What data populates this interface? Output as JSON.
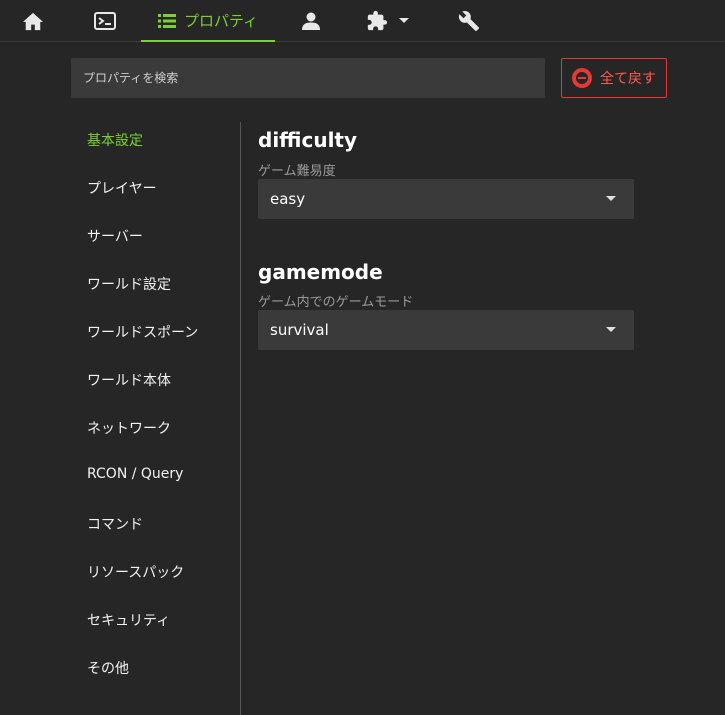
{
  "nav": {
    "home": "home-icon",
    "console": "console-icon",
    "properties_label": "プロパティ",
    "players": "person-icon",
    "plugins": "puzzle-icon",
    "settings": "wrench-icon",
    "accent": "#7cd12e"
  },
  "search": {
    "placeholder": "プロパティを検索"
  },
  "reset": {
    "label": "全て戻す",
    "color": "#e53935"
  },
  "sidebar": {
    "items": [
      {
        "label": "基本設定",
        "active": true
      },
      {
        "label": "プレイヤー"
      },
      {
        "label": "サーバー"
      },
      {
        "label": "ワールド設定"
      },
      {
        "label": "ワールドスポーン"
      },
      {
        "label": "ワールド本体"
      },
      {
        "label": "ネットワーク"
      },
      {
        "label": "RCON / Query"
      },
      {
        "label": "コマンド"
      },
      {
        "label": "リソースパック"
      },
      {
        "label": "セキュリティ"
      },
      {
        "label": "その他"
      }
    ]
  },
  "properties": [
    {
      "name": "difficulty",
      "description": "ゲーム難易度",
      "value": "easy"
    },
    {
      "name": "gamemode",
      "description": "ゲーム内でのゲームモード",
      "value": "survival"
    }
  ]
}
